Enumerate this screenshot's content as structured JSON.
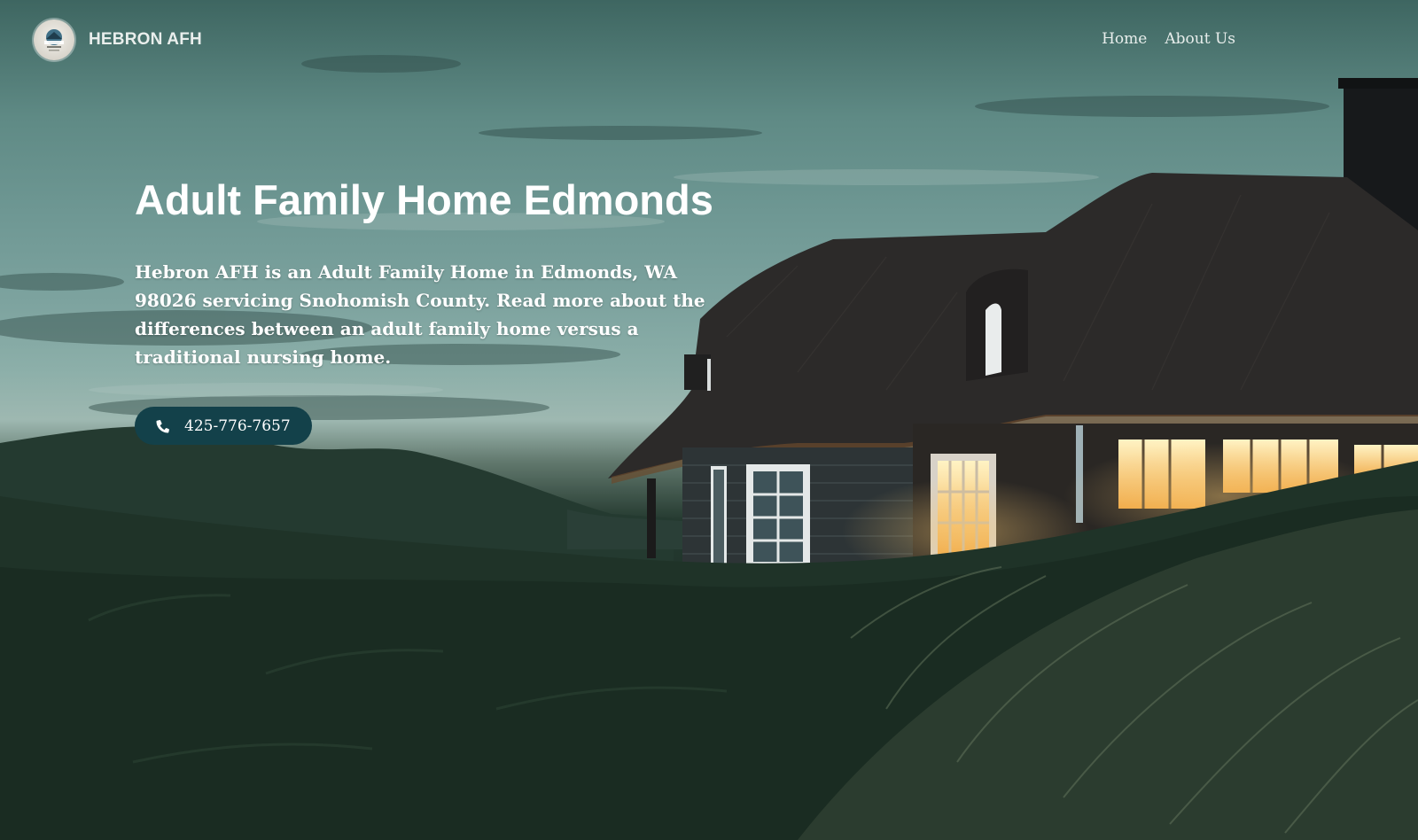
{
  "header": {
    "brand_name": "HEBRON AFH",
    "logo_icon": "hebron-logo-icon",
    "nav": [
      {
        "label": "Home"
      },
      {
        "label": "About Us"
      }
    ]
  },
  "hero": {
    "title": "Adult Family Home Edmonds",
    "description": "Hebron AFH is an Adult Family Home in Edmonds, WA 98026 servicing Snohomish County. Read more about the differences between an adult family home versus a traditional nursing home.",
    "cta": {
      "icon": "phone-icon",
      "label": "425-776-7657"
    },
    "background_image": "thatched-house-on-dunes-at-dusk"
  },
  "colors": {
    "button_bg": "#13414a",
    "text": "#ffffff"
  }
}
